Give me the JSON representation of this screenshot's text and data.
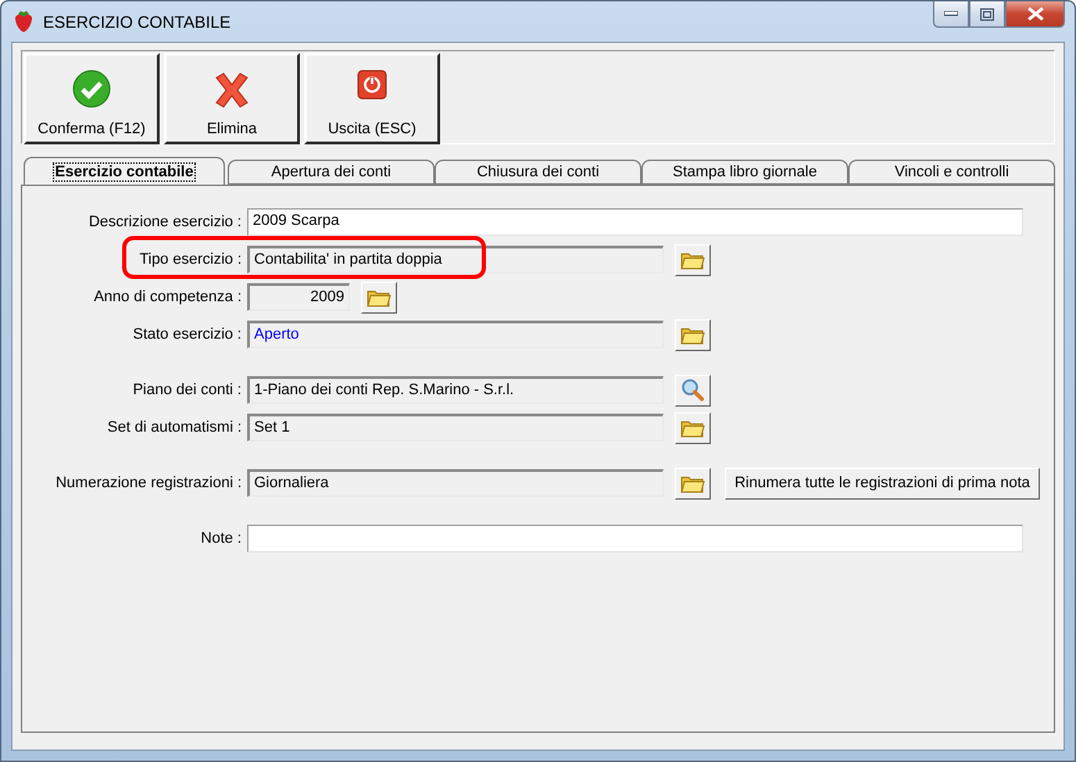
{
  "window": {
    "title": "ESERCIZIO CONTABILE"
  },
  "toolbar": [
    {
      "label": "Conferma (F12)",
      "kind": "confirm"
    },
    {
      "label": "Elimina",
      "kind": "delete"
    },
    {
      "label": "Uscita (ESC)",
      "kind": "exit"
    }
  ],
  "tabs": [
    {
      "label": "Esercizio contabile",
      "selected": true
    },
    {
      "label": "Apertura dei conti",
      "selected": false
    },
    {
      "label": "Chiusura dei conti",
      "selected": false
    },
    {
      "label": "Stampa libro giornale",
      "selected": false
    },
    {
      "label": "Vincoli e controlli",
      "selected": false
    }
  ],
  "groups": [
    [
      {
        "label": "Descrizione esercizio :",
        "value": "2009 Scarpa",
        "kind": "text"
      },
      {
        "label": "Tipo esercizio :",
        "value": "Contabilita' in partita doppia",
        "kind": "choice",
        "highlighted": true
      },
      {
        "label": "Anno di competenza :",
        "value": "2009",
        "kind": "year"
      },
      {
        "label": "Stato esercizio :",
        "value": "Aperto",
        "kind": "choice",
        "color": "#0000ff"
      }
    ],
    [
      {
        "label": "Piano dei conti :",
        "value": "1-Piano dei conti Rep. S.Marino - S.r.l.",
        "kind": "lookup"
      },
      {
        "label": "Set di automatismi :",
        "value": "Set 1",
        "kind": "choice"
      }
    ],
    [
      {
        "label": "Numerazione registrazioni :",
        "value": "Giornaliera",
        "kind": "choice",
        "action": "Rinumera tutte le registrazioni di prima nota"
      }
    ],
    [
      {
        "label": "Note :",
        "kind": "text"
      }
    ]
  ]
}
